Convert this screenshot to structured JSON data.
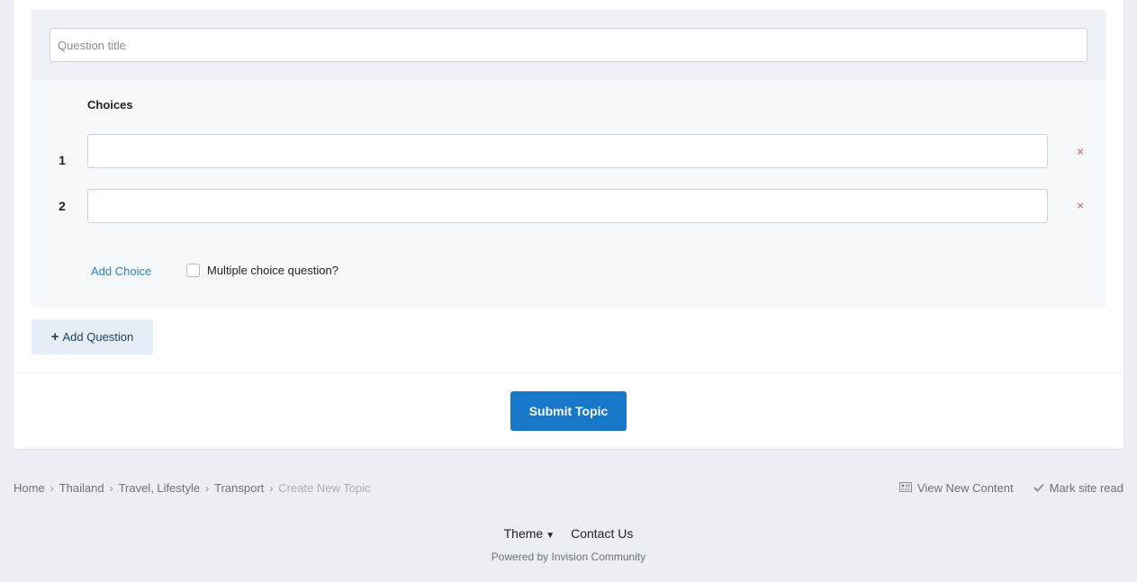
{
  "poll": {
    "question_placeholder": "Question title",
    "question_value": "",
    "choices_label": "Choices",
    "choices": [
      {
        "number": "1",
        "value": ""
      },
      {
        "number": "2",
        "value": ""
      }
    ],
    "remove_icon": "×",
    "add_choice_label": "Add Choice",
    "multiple_choice_label": "Multiple choice question?",
    "multiple_choice_checked": false
  },
  "add_question_label": "Add Question",
  "add_question_icon": "+",
  "submit_label": "Submit Topic",
  "breadcrumb": {
    "items": [
      "Home",
      "Thailand",
      "Travel, Lifestyle",
      "Transport"
    ],
    "current": "Create New Topic",
    "separator": "›"
  },
  "site_links": {
    "view_new_content": "View New Content",
    "mark_site_read": "Mark site read"
  },
  "footer": {
    "theme_label": "Theme",
    "contact_label": "Contact Us",
    "powered_by": "Powered by Invision Community"
  },
  "colors": {
    "accent": "#1777c8",
    "link": "#2d7fc1",
    "remove": "#d9534f",
    "background": "#ebeef2"
  }
}
